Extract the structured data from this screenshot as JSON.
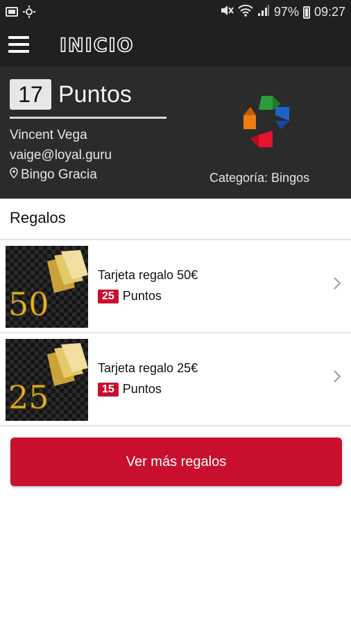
{
  "status_bar": {
    "battery": "97%",
    "time": "09:27",
    "icons": [
      "gallery-icon",
      "brightness-icon",
      "mute-icon",
      "wifi-icon",
      "signal-icon",
      "battery-icon"
    ]
  },
  "app_bar": {
    "title": "INICIO",
    "menu_icon": "hamburger-icon"
  },
  "profile": {
    "points": "17",
    "points_label": "Puntos",
    "name": "Vincent Vega",
    "email": "vaige@loyal.guru",
    "location": "Bingo Gracia",
    "category": "Categoría: Bingos"
  },
  "rewards": {
    "section_title": "Regalos",
    "items": [
      {
        "title": "Tarjeta regalo 50€",
        "points": "25",
        "points_label": "Puntos",
        "thumb_text": "50"
      },
      {
        "title": "Tarjeta regalo 25€",
        "points": "15",
        "points_label": "Puntos",
        "thumb_text": "25"
      }
    ],
    "more_button": "Ver más regalos"
  },
  "colors": {
    "accent": "#c8102e",
    "header_bg": "#202020",
    "profile_bg": "#2b2b2b"
  }
}
